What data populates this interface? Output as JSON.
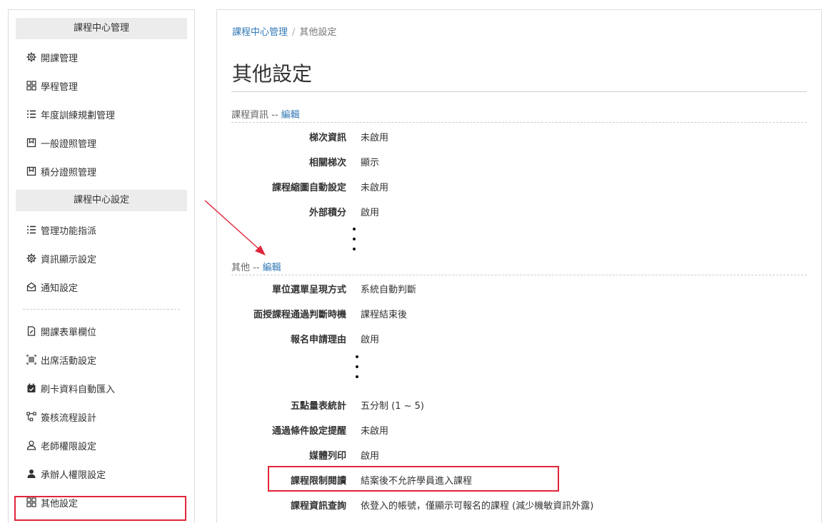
{
  "sidebar": {
    "group1_title": "課程中心管理",
    "group1_items": [
      {
        "label": "開課管理",
        "icon": "gear-icon"
      },
      {
        "label": "學程管理",
        "icon": "grid-icon"
      },
      {
        "label": "年度訓練規劃管理",
        "icon": "list-icon"
      },
      {
        "label": "一般證照管理",
        "icon": "certificate-icon"
      },
      {
        "label": "積分證照管理",
        "icon": "certificate-icon"
      }
    ],
    "group2_title": "課程中心設定",
    "group2_items": [
      {
        "label": "管理功能指派",
        "icon": "list-icon"
      },
      {
        "label": "資訊顯示設定",
        "icon": "gear-icon"
      },
      {
        "label": "通知設定",
        "icon": "envelope-icon"
      }
    ],
    "group3_items": [
      {
        "label": "開課表單欄位",
        "icon": "form-icon"
      },
      {
        "label": "出席活動設定",
        "icon": "barcode-icon"
      },
      {
        "label": "刷卡資料自動匯入",
        "icon": "calendar-icon"
      },
      {
        "label": "簽核流程設計",
        "icon": "flow-icon"
      },
      {
        "label": "老師權限設定",
        "icon": "user-outline-icon"
      },
      {
        "label": "承辦人權限設定",
        "icon": "user-icon"
      },
      {
        "label": "其他設定",
        "icon": "grid-icon"
      }
    ]
  },
  "breadcrumb": {
    "parent": "課程中心管理",
    "separator": "/",
    "current": "其他設定"
  },
  "page_title": "其他設定",
  "section_course": {
    "title": "課程資訊 -- ",
    "edit": "編輯",
    "rows": [
      {
        "label": "梯次資訊",
        "value": "未啟用"
      },
      {
        "label": "相關梯次",
        "value": "顯示"
      },
      {
        "label": "課程縮圖自動設定",
        "value": "未啟用"
      },
      {
        "label": "外部積分",
        "value": "啟用"
      }
    ]
  },
  "section_other": {
    "title": "其他 -- ",
    "edit": "編輯",
    "rows_top": [
      {
        "label": "單位選單呈現方式",
        "value": "系統自動判斷"
      },
      {
        "label": "面授課程通過判斷時機",
        "value": "課程結束後"
      },
      {
        "label": "報名申請理由",
        "value": "啟用"
      }
    ],
    "rows_bottom": [
      {
        "label": "五點量表統計",
        "value": "五分制 (1 ~ 5)"
      },
      {
        "label": "通過條件設定提醒",
        "value": "未啟用"
      },
      {
        "label": "媒體列印",
        "value": "啟用"
      },
      {
        "label": "課程限制閱讀",
        "value": "結案後不允許學員進入課程"
      },
      {
        "label": "課程資訊查詢",
        "value": "依登入的帳號，僅顯示可報名的課程 (減少機敏資訊外露)"
      }
    ]
  },
  "colors": {
    "link": "#337ab7",
    "highlight": "#e0263a"
  }
}
